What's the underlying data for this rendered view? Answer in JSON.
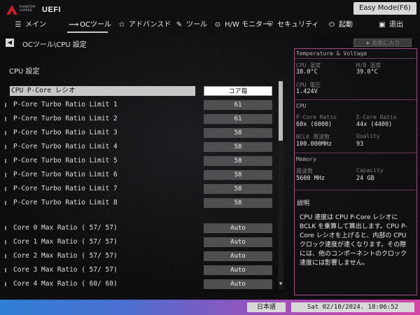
{
  "header": {
    "logo_small": "PHANTOM GAMING",
    "logo_main": "UEFI",
    "easy_mode": "Easy Mode(F6)"
  },
  "nav": [
    {
      "label": "メイン",
      "icon": "menu-icon",
      "glyph": "☰"
    },
    {
      "label": "OCツール",
      "icon": "oc-tweaker-icon",
      "glyph": "⟿"
    },
    {
      "label": "アドバンスド",
      "icon": "star-icon",
      "glyph": "✩"
    },
    {
      "label": "ツール",
      "icon": "wrench-icon",
      "glyph": "✎"
    },
    {
      "label": "H/W モニター",
      "icon": "monitor-icon",
      "glyph": "⊙"
    },
    {
      "label": "セキュリティ",
      "icon": "shield-icon",
      "glyph": "⛨"
    },
    {
      "label": "起動",
      "icon": "power-icon",
      "glyph": "⏻"
    },
    {
      "label": "退出",
      "icon": "exit-icon",
      "glyph": "▣"
    }
  ],
  "breadcrumb": "OCツール\\CPU 設定",
  "favorite": "★ お気に入り",
  "section_title": "CPU 設定",
  "settings": [
    {
      "label": "CPU P-Core レシオ",
      "value": "コア毎",
      "selected": true
    },
    {
      "label": "P-Core Turbo Ratio Limit 1",
      "value": "61"
    },
    {
      "label": "P-Core Turbo Ratio Limit 2",
      "value": "61"
    },
    {
      "label": "P-Core Turbo Ratio Limit 3",
      "value": "58"
    },
    {
      "label": "P-Core Turbo Ratio Limit 4",
      "value": "58"
    },
    {
      "label": "P-Core Turbo Ratio Limit 5",
      "value": "58"
    },
    {
      "label": "P-Core Turbo Ratio Limit 6",
      "value": "58"
    },
    {
      "label": "P-Core Turbo Ratio Limit 7",
      "value": "58"
    },
    {
      "label": "P-Core Turbo Ratio Limit 8",
      "value": "58"
    },
    {
      "label": "Core 0 Max Ratio ( 57/ 57)",
      "value": "Auto"
    },
    {
      "label": "Core 1 Max Ratio ( 57/ 57)",
      "value": "Auto"
    },
    {
      "label": "Core 2 Max Ratio ( 57/ 57)",
      "value": "Auto"
    },
    {
      "label": "Core 3 Max Ratio ( 57/ 57)",
      "value": "Auto"
    },
    {
      "label": "Core 4 Max Ratio ( 60/ 60)",
      "value": "Auto"
    }
  ],
  "panel": {
    "temp_title": "Temperature & Voltage",
    "cpu_temp_label": "CPU 温度",
    "cpu_temp": "38.0°C",
    "mb_temp_label": "M/B 温度",
    "mb_temp": "39.0°C",
    "cpu_volt_label": "CPU 電圧",
    "cpu_volt": "1.424V",
    "cpu_title": "CPU",
    "pcore_label": "P-Core Ratio",
    "pcore": "60x (6000)",
    "ecore_label": "E-Core Ratio",
    "ecore": "44x (4400)",
    "bclk_label": "BCLK 周波数",
    "bclk": "100.000MHz",
    "quality_label": "Quality",
    "quality": "93",
    "mem_title": "Memory",
    "freq_label": "周波数",
    "freq": "5600 MHz",
    "cap_label": "Capacity",
    "cap": "24 GB",
    "desc_title": "説明",
    "desc": "CPU 速度は CPU P-Core レシオに BCLK を乗算して算出します。CPU P-Core レシオを上げると、内部の CPU クロック速度が速くなります。その際には、他のコンポーネントのクロック速度には影響しません。"
  },
  "footer": {
    "language": "日本語",
    "datetime": "Sat 02/10/2024. 18:06:52"
  },
  "colors": {
    "accent_border": "#a84a86",
    "selected_row": "#c8c8c8",
    "value_box": "#4f4f51"
  }
}
